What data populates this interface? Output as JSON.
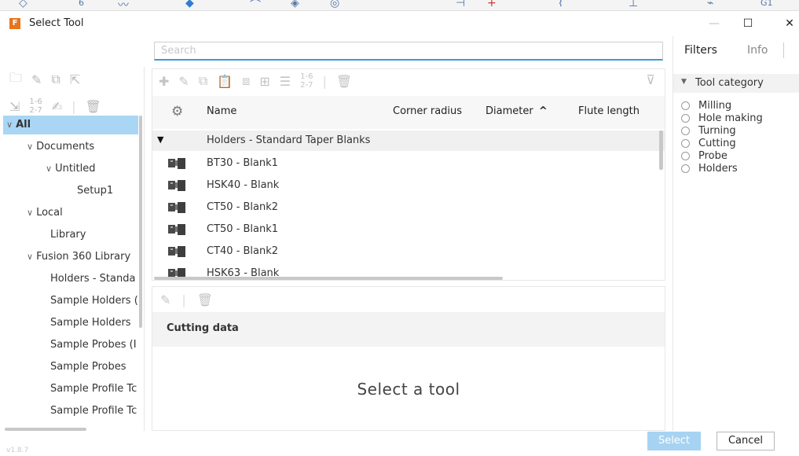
{
  "window": {
    "title": "Select Tool",
    "app_icon_letter": "F",
    "minimize_glyph": "—",
    "maximize_glyph": "☐",
    "close_glyph": "✕"
  },
  "top_strip": {
    "badge_left": "6",
    "badge_right": "G1"
  },
  "search": {
    "placeholder": "Search",
    "value": ""
  },
  "tree": {
    "items": [
      {
        "label": "All",
        "level": 0,
        "expanded": true,
        "selected": true
      },
      {
        "label": "Documents",
        "level": 1,
        "expanded": true
      },
      {
        "label": "Untitled",
        "level": 2,
        "expanded": true
      },
      {
        "label": "Setup1",
        "level": 3
      },
      {
        "label": "Local",
        "level": 1,
        "expanded": true
      },
      {
        "label": "Library",
        "level": 2
      },
      {
        "label": "Fusion 360 Library",
        "level": 1,
        "expanded": true
      },
      {
        "label": "Holders - Standa",
        "level": 2
      },
      {
        "label": "Sample Holders (",
        "level": 2
      },
      {
        "label": "Sample Holders",
        "level": 2
      },
      {
        "label": "Sample Probes (I",
        "level": 2
      },
      {
        "label": "Sample Probes",
        "level": 2
      },
      {
        "label": "Sample Profile Tc",
        "level": 2
      },
      {
        "label": "Sample Profile Tc",
        "level": 2
      }
    ]
  },
  "tool_table": {
    "columns": [
      "Name",
      "Corner radius",
      "Diameter",
      "Flute length"
    ],
    "sort_indicator": "^",
    "group": "Holders - Standard Taper Blanks",
    "rows": [
      "BT30 - Blank1",
      "HSK40 - Blank",
      "CT50 - Blank2",
      "CT50 - Blank1",
      "CT40 - Blank2",
      "HSK63 - Blank"
    ]
  },
  "detail": {
    "section_title": "Cutting data",
    "empty_message": "Select a tool"
  },
  "filters": {
    "tabs": [
      "Filters",
      "Info"
    ],
    "active_tab": "Filters",
    "section_title": "Tool category",
    "categories": [
      "Milling",
      "Hole making",
      "Turning",
      "Cutting",
      "Probe",
      "Holders"
    ]
  },
  "buttons": {
    "select": "Select",
    "cancel": "Cancel"
  },
  "version_text": "v1.8.7",
  "colors": {
    "selection": "#a9d6f5",
    "accent": "#3a9bd8",
    "select_button": "#a7d3f2"
  }
}
